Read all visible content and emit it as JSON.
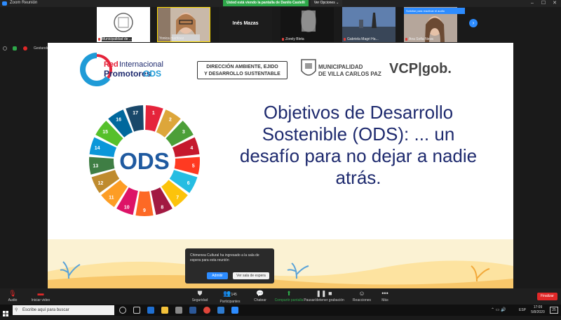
{
  "window": {
    "title": "Zoom Reunión"
  },
  "share_banner": "Usted está viendo la pantalla de Danilo Castelli",
  "view_options": "Ver Opciones",
  "tooltip": "Solicitar para reactivar el audio",
  "participants": [
    {
      "name": "Municipalidad de ...",
      "muted": true
    },
    {
      "name": "Yonica martinez",
      "muted": false
    },
    {
      "name": "Inés Mazas",
      "muted": false
    },
    {
      "name": "Zorely Bleta",
      "muted": true
    },
    {
      "name": "Gabriela Magri Ha...",
      "muted": true
    },
    {
      "name": "Ana Sofia Neva",
      "muted": true
    }
  ],
  "share_controls": {
    "label": "Gestando..."
  },
  "slide": {
    "logo1": {
      "line1": "Red",
      "line2": "Internacional",
      "line3": "Promotores",
      "line4": "ODS"
    },
    "logo2": {
      "line1": "DIRECCIÓN AMBIENTE, EJIDO",
      "line2": "Y DESARROLLO SUSTENTABLE"
    },
    "logo3": {
      "line1": "MUNICIPALIDAD",
      "line2": "DE VILLA CARLOS PAZ"
    },
    "logo4": "VCP|gob.",
    "wheel_label": "ODS",
    "title_lines": [
      "Objetivos de Desarrollo",
      "Sostenible (ODS): ... un",
      "desafío para no dejar a nadie",
      "atrás."
    ],
    "sdg_numbers": [
      "1",
      "2",
      "3",
      "4",
      "5",
      "6",
      "7",
      "8",
      "9",
      "10",
      "11",
      "12",
      "13",
      "14",
      "15",
      "16",
      "17"
    ],
    "sdg_colors": [
      "#e5243b",
      "#dda63a",
      "#4c9f38",
      "#c5192d",
      "#ff3a21",
      "#26bde2",
      "#fcc30b",
      "#a21942",
      "#fd6925",
      "#dd1367",
      "#fd9d24",
      "#bf8b2e",
      "#3f7e44",
      "#0a97d9",
      "#56c02b",
      "#00689d",
      "#19486a"
    ]
  },
  "notification": {
    "message": "Chimenea Cultural ha ingresado a la sala de espera para esta reunión",
    "admit": "Admitir",
    "waiting_room": "Ver sala de espera"
  },
  "toolbar": {
    "audio": "Audio",
    "video": "Iniciar video",
    "security": "Seguridad",
    "participants": "Participantes",
    "participant_count": "145",
    "chat": "Chatear",
    "share": "Compartir pantalla",
    "record": "Pausar/detener grabación",
    "reactions": "Reacciones",
    "more": "Más",
    "end": "Finalizar"
  },
  "taskbar": {
    "search": "Escribe aquí para buscar",
    "lang": "ESP",
    "time": "17:09",
    "date": "5/8/2020",
    "notif_count": "25"
  }
}
